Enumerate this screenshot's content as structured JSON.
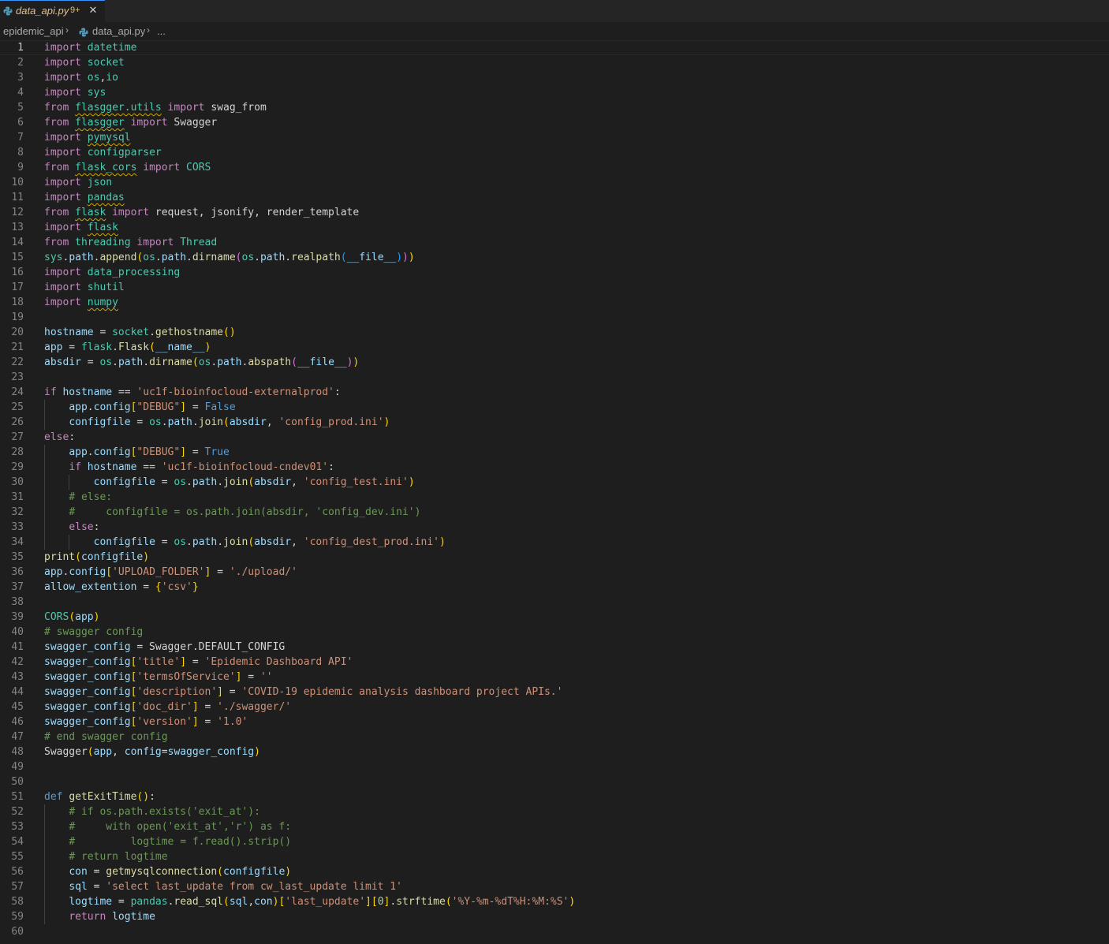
{
  "tab": {
    "title": "data_api.py",
    "badge": "9+",
    "close": "✕"
  },
  "breadcrumb": {
    "folder": "epidemic_api",
    "sep": "›",
    "file": "data_api.py",
    "more": "..."
  },
  "editor": {
    "active_line": 1,
    "indent_guides": [
      {
        "col": 0,
        "from": 25,
        "to": 26
      },
      {
        "col": 0,
        "from": 28,
        "to": 34
      },
      {
        "col": 1,
        "from": 30,
        "to": 30
      },
      {
        "col": 1,
        "from": 34,
        "to": 34
      },
      {
        "col": 0,
        "from": 52,
        "to": 59
      }
    ],
    "lines": [
      [
        [
          "kw",
          "import"
        ],
        [
          "txt",
          " "
        ],
        [
          "mod",
          "datetime"
        ]
      ],
      [
        [
          "kw",
          "import"
        ],
        [
          "txt",
          " "
        ],
        [
          "mod",
          "socket"
        ]
      ],
      [
        [
          "kw",
          "import"
        ],
        [
          "txt",
          " "
        ],
        [
          "mod",
          "os"
        ],
        [
          "txt",
          ","
        ],
        [
          "mod",
          "io"
        ]
      ],
      [
        [
          "kw",
          "import"
        ],
        [
          "txt",
          " "
        ],
        [
          "mod",
          "sys"
        ]
      ],
      [
        [
          "kw",
          "from"
        ],
        [
          "txt",
          " "
        ],
        [
          "sq",
          "flasgger.utils"
        ],
        [
          "txt",
          " "
        ],
        [
          "kw",
          "import"
        ],
        [
          "txt",
          " swag_from"
        ]
      ],
      [
        [
          "kw",
          "from"
        ],
        [
          "txt",
          " "
        ],
        [
          "sq",
          "flasgger"
        ],
        [
          "txt",
          " "
        ],
        [
          "kw",
          "import"
        ],
        [
          "txt",
          " Swagger"
        ]
      ],
      [
        [
          "kw",
          "import"
        ],
        [
          "txt",
          " "
        ],
        [
          "sqm",
          "pymysql"
        ]
      ],
      [
        [
          "kw",
          "import"
        ],
        [
          "txt",
          " "
        ],
        [
          "mod",
          "configparser"
        ]
      ],
      [
        [
          "kw",
          "from"
        ],
        [
          "txt",
          " "
        ],
        [
          "sq",
          "flask_cors"
        ],
        [
          "txt",
          " "
        ],
        [
          "kw",
          "import"
        ],
        [
          "txt",
          " "
        ],
        [
          "cls",
          "CORS"
        ]
      ],
      [
        [
          "kw",
          "import"
        ],
        [
          "txt",
          " "
        ],
        [
          "mod",
          "json"
        ]
      ],
      [
        [
          "kw",
          "import"
        ],
        [
          "txt",
          " "
        ],
        [
          "sqm",
          "pandas"
        ]
      ],
      [
        [
          "kw",
          "from"
        ],
        [
          "txt",
          " "
        ],
        [
          "sq",
          "flask"
        ],
        [
          "txt",
          " "
        ],
        [
          "kw",
          "import"
        ],
        [
          "txt",
          " request, jsonify, render_template"
        ]
      ],
      [
        [
          "kw",
          "import"
        ],
        [
          "txt",
          " "
        ],
        [
          "sqm",
          "flask"
        ]
      ],
      [
        [
          "kw",
          "from"
        ],
        [
          "txt",
          " "
        ],
        [
          "mod",
          "threading"
        ],
        [
          "txt",
          " "
        ],
        [
          "kw",
          "import"
        ],
        [
          "txt",
          " "
        ],
        [
          "cls",
          "Thread"
        ]
      ],
      [
        [
          "mod",
          "sys"
        ],
        [
          "txt",
          "."
        ],
        [
          "var",
          "path"
        ],
        [
          "txt",
          "."
        ],
        [
          "fn",
          "append"
        ],
        [
          "b1",
          "("
        ],
        [
          "mod",
          "os"
        ],
        [
          "txt",
          "."
        ],
        [
          "var",
          "path"
        ],
        [
          "txt",
          "."
        ],
        [
          "fn",
          "dirname"
        ],
        [
          "b2",
          "("
        ],
        [
          "mod",
          "os"
        ],
        [
          "txt",
          "."
        ],
        [
          "var",
          "path"
        ],
        [
          "txt",
          "."
        ],
        [
          "fn",
          "realpath"
        ],
        [
          "b3",
          "("
        ],
        [
          "var",
          "__file__"
        ],
        [
          "b3",
          ")"
        ],
        [
          "b2",
          ")"
        ],
        [
          "b1",
          ")"
        ]
      ],
      [
        [
          "kw",
          "import"
        ],
        [
          "txt",
          " "
        ],
        [
          "mod",
          "data_processing"
        ]
      ],
      [
        [
          "kw",
          "import"
        ],
        [
          "txt",
          " "
        ],
        [
          "mod",
          "shutil"
        ]
      ],
      [
        [
          "kw",
          "import"
        ],
        [
          "txt",
          " "
        ],
        [
          "sqm",
          "numpy"
        ]
      ],
      [],
      [
        [
          "var",
          "hostname"
        ],
        [
          "txt",
          " = "
        ],
        [
          "mod",
          "socket"
        ],
        [
          "txt",
          "."
        ],
        [
          "fn",
          "gethostname"
        ],
        [
          "b1",
          "()"
        ]
      ],
      [
        [
          "var",
          "app"
        ],
        [
          "txt",
          " = "
        ],
        [
          "mod",
          "flask"
        ],
        [
          "txt",
          "."
        ],
        [
          "fn",
          "Flask"
        ],
        [
          "b1",
          "("
        ],
        [
          "var",
          "__name__"
        ],
        [
          "b1",
          ")"
        ]
      ],
      [
        [
          "var",
          "absdir"
        ],
        [
          "txt",
          " = "
        ],
        [
          "mod",
          "os"
        ],
        [
          "txt",
          "."
        ],
        [
          "var",
          "path"
        ],
        [
          "txt",
          "."
        ],
        [
          "fn",
          "dirname"
        ],
        [
          "b1",
          "("
        ],
        [
          "mod",
          "os"
        ],
        [
          "txt",
          "."
        ],
        [
          "var",
          "path"
        ],
        [
          "txt",
          "."
        ],
        [
          "fn",
          "abspath"
        ],
        [
          "b2",
          "("
        ],
        [
          "var",
          "__file__"
        ],
        [
          "b2",
          ")"
        ],
        [
          "b1",
          ")"
        ]
      ],
      [],
      [
        [
          "kw",
          "if"
        ],
        [
          "txt",
          " "
        ],
        [
          "var",
          "hostname"
        ],
        [
          "txt",
          " == "
        ],
        [
          "str",
          "'uc1f-bioinfocloud-externalprod'"
        ],
        [
          "txt",
          ":"
        ]
      ],
      [
        [
          "txt",
          "    "
        ],
        [
          "var",
          "app"
        ],
        [
          "txt",
          "."
        ],
        [
          "var",
          "config"
        ],
        [
          "b1",
          "["
        ],
        [
          "str",
          "\"DEBUG\""
        ],
        [
          "b1",
          "]"
        ],
        [
          "txt",
          " = "
        ],
        [
          "kw2",
          "False"
        ]
      ],
      [
        [
          "txt",
          "    "
        ],
        [
          "var",
          "configfile"
        ],
        [
          "txt",
          " = "
        ],
        [
          "mod",
          "os"
        ],
        [
          "txt",
          "."
        ],
        [
          "var",
          "path"
        ],
        [
          "txt",
          "."
        ],
        [
          "fn",
          "join"
        ],
        [
          "b1",
          "("
        ],
        [
          "var",
          "absdir"
        ],
        [
          "txt",
          ", "
        ],
        [
          "str",
          "'config_prod.ini'"
        ],
        [
          "b1",
          ")"
        ]
      ],
      [
        [
          "kw",
          "else"
        ],
        [
          "txt",
          ":"
        ]
      ],
      [
        [
          "txt",
          "    "
        ],
        [
          "var",
          "app"
        ],
        [
          "txt",
          "."
        ],
        [
          "var",
          "config"
        ],
        [
          "b1",
          "["
        ],
        [
          "str",
          "\"DEBUG\""
        ],
        [
          "b1",
          "]"
        ],
        [
          "txt",
          " = "
        ],
        [
          "kw2",
          "True"
        ]
      ],
      [
        [
          "txt",
          "    "
        ],
        [
          "kw",
          "if"
        ],
        [
          "txt",
          " "
        ],
        [
          "var",
          "hostname"
        ],
        [
          "txt",
          " == "
        ],
        [
          "str",
          "'uc1f-bioinfocloud-cndev01'"
        ],
        [
          "txt",
          ":"
        ]
      ],
      [
        [
          "txt",
          "        "
        ],
        [
          "var",
          "configfile"
        ],
        [
          "txt",
          " = "
        ],
        [
          "mod",
          "os"
        ],
        [
          "txt",
          "."
        ],
        [
          "var",
          "path"
        ],
        [
          "txt",
          "."
        ],
        [
          "fn",
          "join"
        ],
        [
          "b1",
          "("
        ],
        [
          "var",
          "absdir"
        ],
        [
          "txt",
          ", "
        ],
        [
          "str",
          "'config_test.ini'"
        ],
        [
          "b1",
          ")"
        ]
      ],
      [
        [
          "txt",
          "    "
        ],
        [
          "cmt",
          "# else:"
        ]
      ],
      [
        [
          "txt",
          "    "
        ],
        [
          "cmt",
          "#     configfile = os.path.join(absdir, 'config_dev.ini')"
        ]
      ],
      [
        [
          "txt",
          "    "
        ],
        [
          "kw",
          "else"
        ],
        [
          "txt",
          ":"
        ]
      ],
      [
        [
          "txt",
          "        "
        ],
        [
          "var",
          "configfile"
        ],
        [
          "txt",
          " = "
        ],
        [
          "mod",
          "os"
        ],
        [
          "txt",
          "."
        ],
        [
          "var",
          "path"
        ],
        [
          "txt",
          "."
        ],
        [
          "fn",
          "join"
        ],
        [
          "b1",
          "("
        ],
        [
          "var",
          "absdir"
        ],
        [
          "txt",
          ", "
        ],
        [
          "str",
          "'config_dest_prod.ini'"
        ],
        [
          "b1",
          ")"
        ]
      ],
      [
        [
          "fn",
          "print"
        ],
        [
          "b1",
          "("
        ],
        [
          "var",
          "configfile"
        ],
        [
          "b1",
          ")"
        ]
      ],
      [
        [
          "var",
          "app"
        ],
        [
          "txt",
          "."
        ],
        [
          "var",
          "config"
        ],
        [
          "b1",
          "["
        ],
        [
          "str",
          "'UPLOAD_FOLDER'"
        ],
        [
          "b1",
          "]"
        ],
        [
          "txt",
          " = "
        ],
        [
          "str",
          "'./upload/'"
        ]
      ],
      [
        [
          "var",
          "allow_extention"
        ],
        [
          "txt",
          " = "
        ],
        [
          "b1",
          "{"
        ],
        [
          "str",
          "'csv'"
        ],
        [
          "b1",
          "}"
        ]
      ],
      [],
      [
        [
          "cls",
          "CORS"
        ],
        [
          "b1",
          "("
        ],
        [
          "var",
          "app"
        ],
        [
          "b1",
          ")"
        ]
      ],
      [
        [
          "cmt",
          "# swagger config"
        ]
      ],
      [
        [
          "var",
          "swagger_config"
        ],
        [
          "txt",
          " = Swagger.DEFAULT_CONFIG"
        ]
      ],
      [
        [
          "var",
          "swagger_config"
        ],
        [
          "b1",
          "["
        ],
        [
          "str",
          "'title'"
        ],
        [
          "b1",
          "]"
        ],
        [
          "txt",
          " = "
        ],
        [
          "str",
          "'Epidemic Dashboard API'"
        ]
      ],
      [
        [
          "var",
          "swagger_config"
        ],
        [
          "b1",
          "["
        ],
        [
          "str",
          "'termsOfService'"
        ],
        [
          "b1",
          "]"
        ],
        [
          "txt",
          " = "
        ],
        [
          "str",
          "''"
        ]
      ],
      [
        [
          "var",
          "swagger_config"
        ],
        [
          "b1",
          "["
        ],
        [
          "str",
          "'description'"
        ],
        [
          "b1",
          "]"
        ],
        [
          "txt",
          " = "
        ],
        [
          "str",
          "'COVID-19 epidemic analysis dashboard project APIs.'"
        ]
      ],
      [
        [
          "var",
          "swagger_config"
        ],
        [
          "b1",
          "["
        ],
        [
          "str",
          "'doc_dir'"
        ],
        [
          "b1",
          "]"
        ],
        [
          "txt",
          " = "
        ],
        [
          "str",
          "'./swagger/'"
        ]
      ],
      [
        [
          "var",
          "swagger_config"
        ],
        [
          "b1",
          "["
        ],
        [
          "str",
          "'version'"
        ],
        [
          "b1",
          "]"
        ],
        [
          "txt",
          " = "
        ],
        [
          "str",
          "'1.0'"
        ]
      ],
      [
        [
          "cmt",
          "# end swagger config"
        ]
      ],
      [
        [
          "txt",
          "Swagger"
        ],
        [
          "b1",
          "("
        ],
        [
          "var",
          "app"
        ],
        [
          "txt",
          ", "
        ],
        [
          "var",
          "config"
        ],
        [
          "txt",
          "="
        ],
        [
          "var",
          "swagger_config"
        ],
        [
          "b1",
          ")"
        ]
      ],
      [],
      [],
      [
        [
          "kw2",
          "def"
        ],
        [
          "txt",
          " "
        ],
        [
          "fn",
          "getExitTime"
        ],
        [
          "b1",
          "()"
        ],
        [
          "txt",
          ":"
        ]
      ],
      [
        [
          "txt",
          "    "
        ],
        [
          "cmt",
          "# if os.path.exists('exit_at'):"
        ]
      ],
      [
        [
          "txt",
          "    "
        ],
        [
          "cmt",
          "#     with open('exit_at','r') as f:"
        ]
      ],
      [
        [
          "txt",
          "    "
        ],
        [
          "cmt",
          "#         logtime = f.read().strip()"
        ]
      ],
      [
        [
          "txt",
          "    "
        ],
        [
          "cmt",
          "# return logtime"
        ]
      ],
      [
        [
          "txt",
          "    "
        ],
        [
          "var",
          "con"
        ],
        [
          "txt",
          " = "
        ],
        [
          "fn",
          "getmysqlconnection"
        ],
        [
          "b1",
          "("
        ],
        [
          "var",
          "configfile"
        ],
        [
          "b1",
          ")"
        ]
      ],
      [
        [
          "txt",
          "    "
        ],
        [
          "var",
          "sql"
        ],
        [
          "txt",
          " = "
        ],
        [
          "str",
          "'select last_update from cw_last_update limit 1'"
        ]
      ],
      [
        [
          "txt",
          "    "
        ],
        [
          "var",
          "logtime"
        ],
        [
          "txt",
          " = "
        ],
        [
          "sqm0",
          "pandas"
        ],
        [
          "txt",
          "."
        ],
        [
          "fn",
          "read_sql"
        ],
        [
          "b1",
          "("
        ],
        [
          "var",
          "sql"
        ],
        [
          "txt",
          ","
        ],
        [
          "var",
          "con"
        ],
        [
          "b1",
          ")"
        ],
        [
          "b1",
          "["
        ],
        [
          "str",
          "'last_update'"
        ],
        [
          "b1",
          "]"
        ],
        [
          "b1",
          "["
        ],
        [
          "num",
          "0"
        ],
        [
          "b1",
          "]"
        ],
        [
          "txt",
          "."
        ],
        [
          "fn",
          "strftime"
        ],
        [
          "b1",
          "("
        ],
        [
          "str",
          "'%Y-%m-%dT%H:%M:%S'"
        ],
        [
          "b1",
          ")"
        ]
      ],
      [
        [
          "txt",
          "    "
        ],
        [
          "kw",
          "return"
        ],
        [
          "txt",
          " "
        ],
        [
          "var",
          "logtime"
        ]
      ],
      []
    ]
  }
}
